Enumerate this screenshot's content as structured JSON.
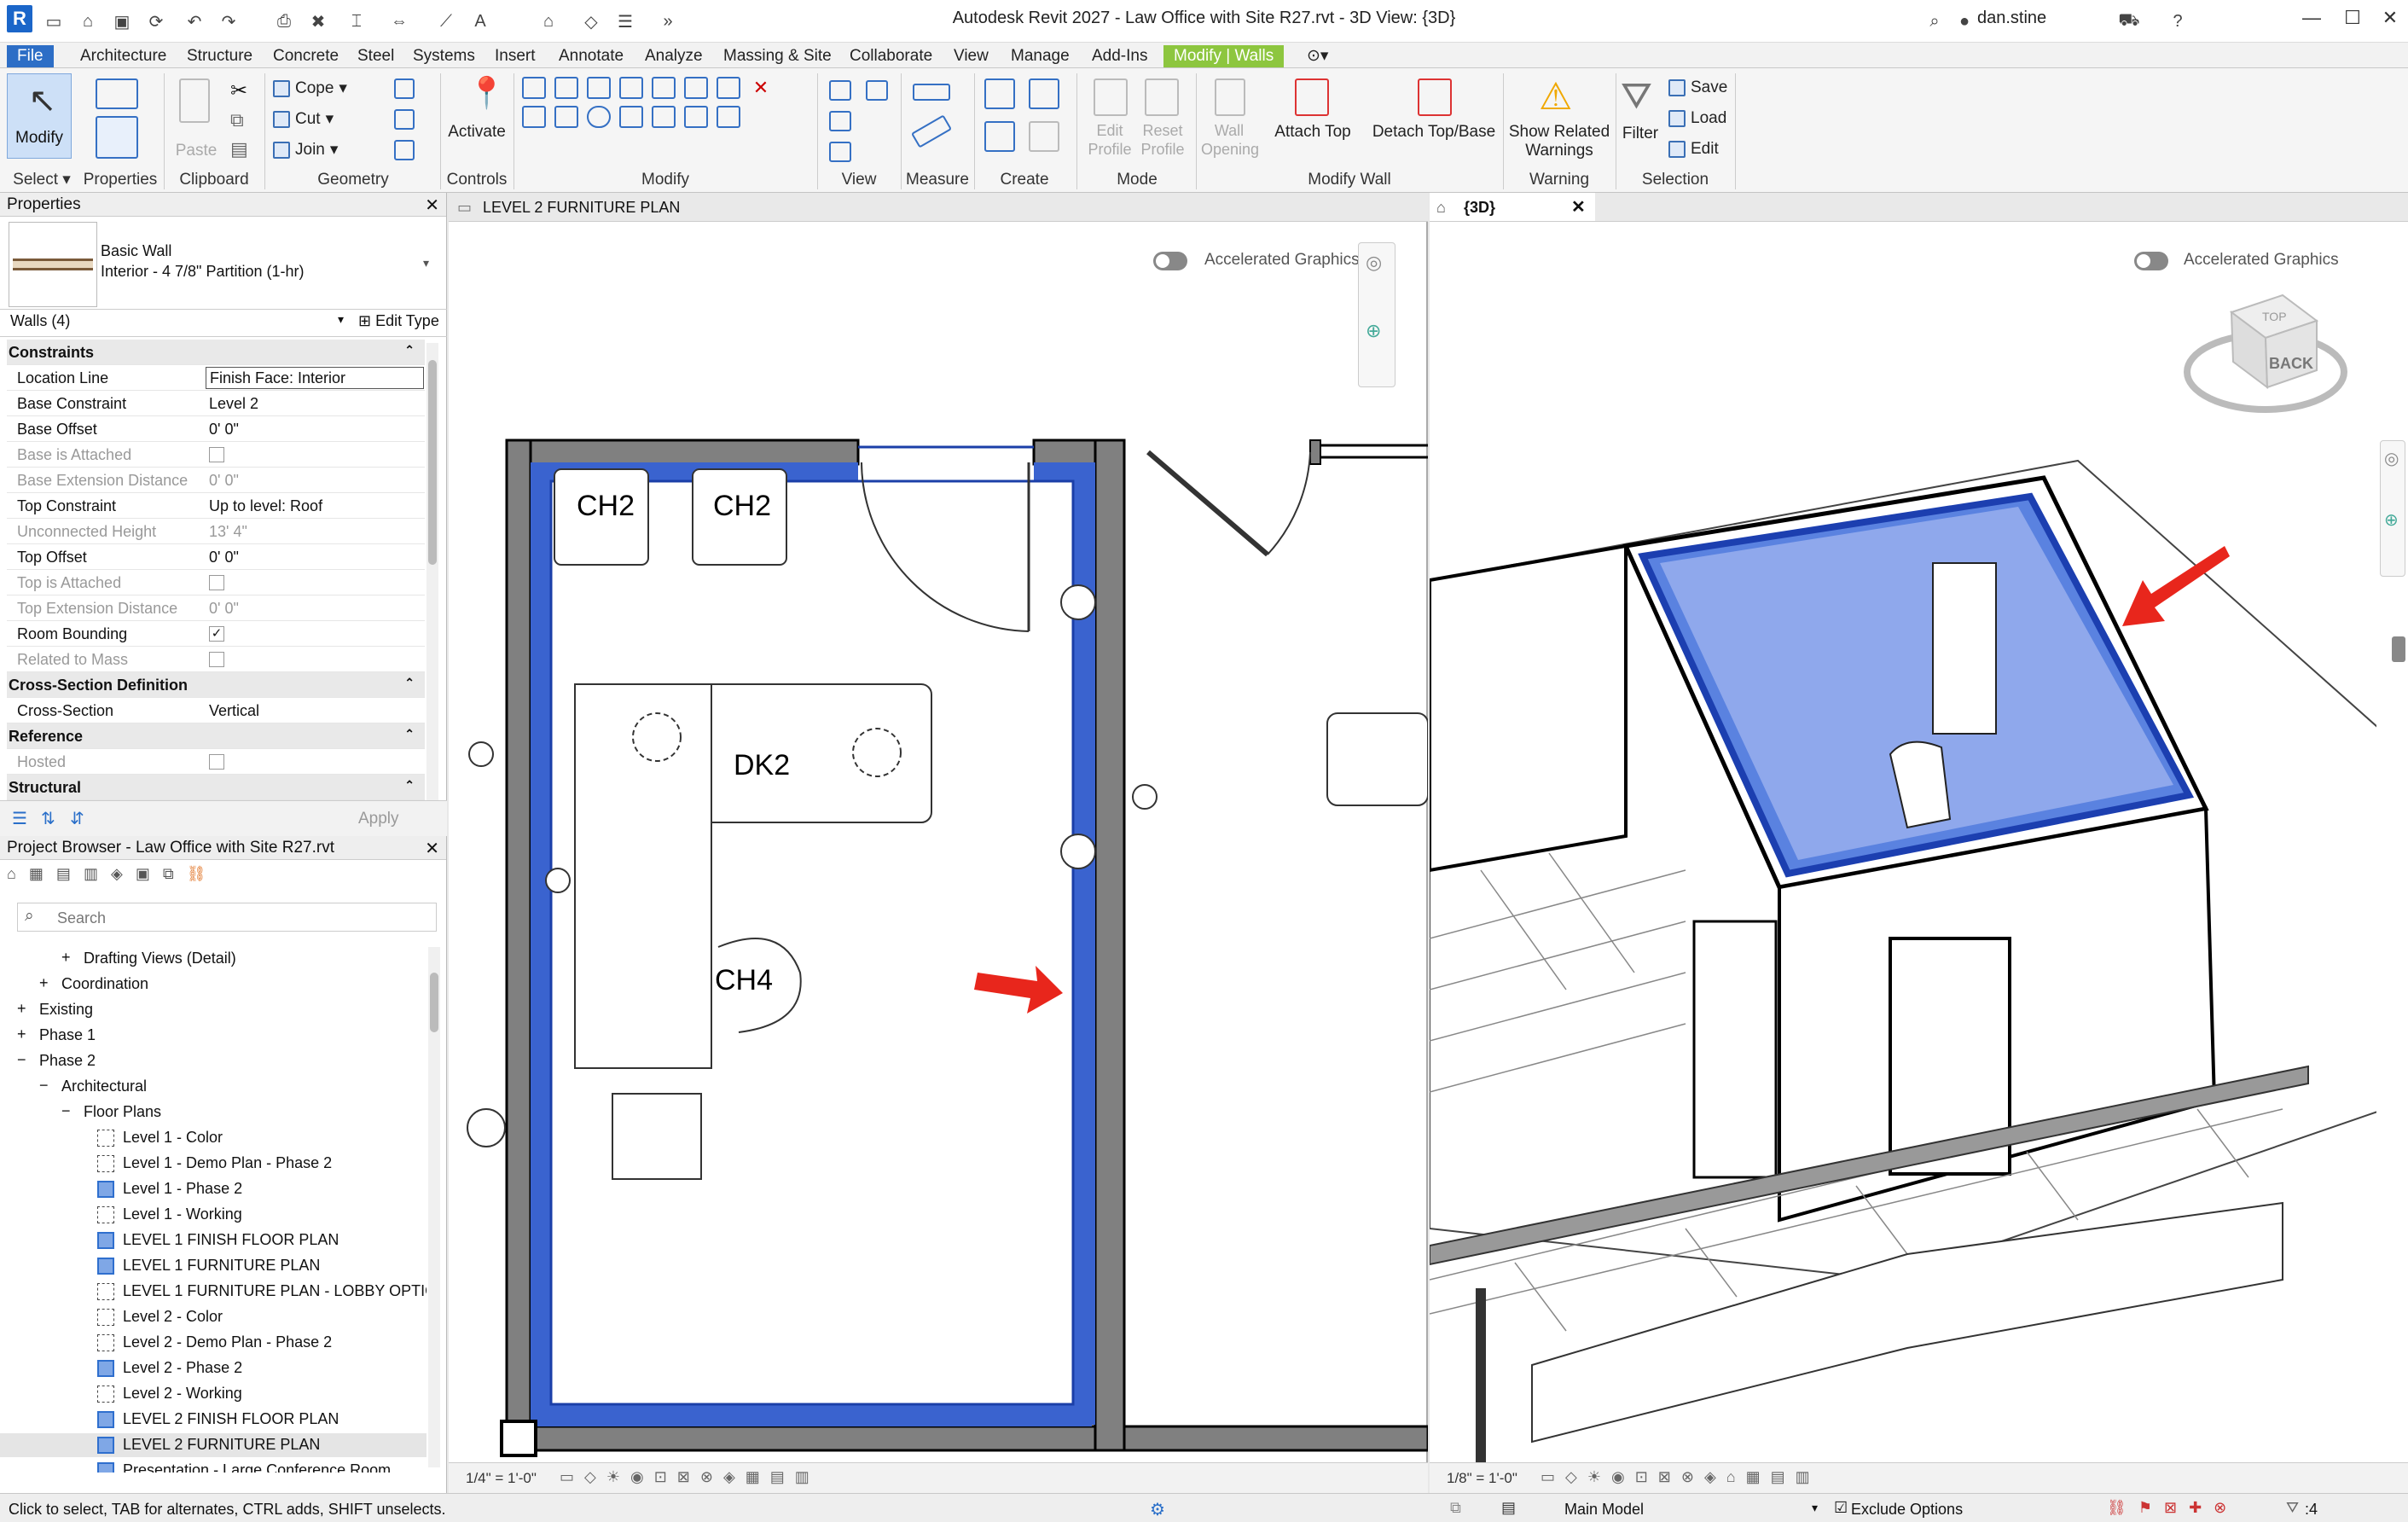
{
  "window": {
    "title": "Autodesk Revit 2027 - Law Office with Site R27.rvt - 3D View: {3D}",
    "user": "dan.stine",
    "logo": "R"
  },
  "tabs": [
    "File",
    "Architecture",
    "Structure",
    "Concrete",
    "Steel",
    "Systems",
    "Insert",
    "Annotate",
    "Analyze",
    "Massing & Site",
    "Collaborate",
    "View",
    "Manage",
    "Add-Ins",
    "Modify | Walls"
  ],
  "ribbon": {
    "modify": "Modify",
    "select": "Select",
    "properties": "Properties",
    "paste": "Paste",
    "clipboard": "Clipboard",
    "cope": "Cope",
    "cut": "Cut",
    "join": "Join",
    "geometry": "Geometry",
    "activate": "Activate",
    "controls": "Controls",
    "modify_panel": "Modify",
    "view_panel": "View",
    "measure": "Measure",
    "create": "Create",
    "edit_profile": "Edit Profile",
    "reset_profile": "Reset Profile",
    "mode": "Mode",
    "wall_opening": "Wall Opening",
    "attach_top": "Attach Top",
    "detach_top_base": "Detach Top/Base",
    "modify_wall": "Modify Wall",
    "show_related_warnings": "Show Related Warnings",
    "warning": "Warning",
    "filter": "Filter",
    "save": "Save",
    "load": "Load",
    "edit": "Edit",
    "selection": "Selection"
  },
  "properties": {
    "title": "Properties",
    "type_family": "Basic Wall",
    "type_name": "Interior - 4 7/8\" Partition (1-hr)",
    "selection": "Walls (4)",
    "edit_type": "Edit Type",
    "apply": "Apply",
    "rows": [
      {
        "k": "Constraints",
        "section": true
      },
      {
        "k": "Location Line",
        "v": "Finish Face: Interior",
        "input": true
      },
      {
        "k": "Base Constraint",
        "v": "Level 2"
      },
      {
        "k": "Base Offset",
        "v": "0'  0\""
      },
      {
        "k": "Base is Attached",
        "chk": "",
        "dis": true
      },
      {
        "k": "Base Extension Distance",
        "v": "0'  0\"",
        "dis": true
      },
      {
        "k": "Top Constraint",
        "v": "Up to level: Roof"
      },
      {
        "k": "Unconnected Height",
        "v": "13'  4\"",
        "dis": true
      },
      {
        "k": "Top Offset",
        "v": "0'  0\""
      },
      {
        "k": "Top is Attached",
        "chk": "",
        "dis": true
      },
      {
        "k": "Top Extension Distance",
        "v": "0'  0\"",
        "dis": true
      },
      {
        "k": "Room Bounding",
        "chk": "✓"
      },
      {
        "k": "Related to Mass",
        "chk": "",
        "dis": true
      },
      {
        "k": "Cross-Section Definition",
        "section": true
      },
      {
        "k": "Cross-Section",
        "v": "Vertical"
      },
      {
        "k": "Reference",
        "section": true
      },
      {
        "k": "Hosted",
        "chk": "",
        "dis": true
      },
      {
        "k": "Structural",
        "section": true
      }
    ]
  },
  "project_browser": {
    "title": "Project Browser - Law Office with Site R27.rvt",
    "search_placeholder": "Search",
    "items": [
      {
        "t": "Drafting Views (Detail)",
        "lvl": 2,
        "exp": "+"
      },
      {
        "t": "Coordination",
        "lvl": 1,
        "exp": "+"
      },
      {
        "t": "Existing",
        "lvl": 0,
        "exp": "+"
      },
      {
        "t": "Phase 1",
        "lvl": 0,
        "exp": "+"
      },
      {
        "t": "Phase 2",
        "lvl": 0,
        "exp": "−"
      },
      {
        "t": "Architectural",
        "lvl": 1,
        "exp": "−"
      },
      {
        "t": "Floor Plans",
        "lvl": 2,
        "exp": "−"
      },
      {
        "t": "Level 1 - Color",
        "lvl": 3,
        "icon": "plain"
      },
      {
        "t": "Level 1 - Demo Plan - Phase 2",
        "lvl": 3,
        "icon": "plain"
      },
      {
        "t": "Level 1 - Phase 2",
        "lvl": 3,
        "icon": "blue"
      },
      {
        "t": "Level 1 - Working",
        "lvl": 3,
        "icon": "plain"
      },
      {
        "t": "LEVEL 1 FINISH FLOOR PLAN",
        "lvl": 3,
        "icon": "blue"
      },
      {
        "t": "LEVEL 1 FURNITURE PLAN",
        "lvl": 3,
        "icon": "blue"
      },
      {
        "t": "LEVEL 1 FURNITURE PLAN - LOBBY OPTIO",
        "lvl": 3,
        "icon": "plain"
      },
      {
        "t": "Level 2 - Color",
        "lvl": 3,
        "icon": "plain"
      },
      {
        "t": "Level 2 - Demo Plan - Phase 2",
        "lvl": 3,
        "icon": "plain"
      },
      {
        "t": "Level 2 - Phase 2",
        "lvl": 3,
        "icon": "blue"
      },
      {
        "t": "Level 2 - Working",
        "lvl": 3,
        "icon": "plain"
      },
      {
        "t": "LEVEL 2 FINISH FLOOR PLAN",
        "lvl": 3,
        "icon": "blue"
      },
      {
        "t": "LEVEL 2 FURNITURE PLAN",
        "lvl": 3,
        "icon": "blue"
      },
      {
        "t": "Presentation - Large Conference Room",
        "lvl": 3,
        "icon": "blue"
      }
    ]
  },
  "view_plan": {
    "tab": "LEVEL 2 FURNITURE PLAN",
    "accel": "Accelerated Graphics",
    "scale": "1/4\" = 1'-0\"",
    "labels": {
      "ch2a": "CH2",
      "ch2b": "CH2",
      "dk2": "DK2",
      "ch4": "CH4"
    }
  },
  "view_3d": {
    "tab": "{3D}",
    "accel": "Accelerated Graphics",
    "scale": "1/8\" = 1'-0\"",
    "cube_face": "BACK",
    "cube_top": "TOP"
  },
  "status": {
    "hint": "Click to select, TAB for alternates, CTRL adds, SHIFT unselects.",
    "model": "Main Model",
    "exclude": "Exclude Options",
    "filter_count": ":4"
  },
  "colors": {
    "accent": "#2d6ec6",
    "selection": "#3a63cf",
    "context_tab": "#8dc63f",
    "arrow": "#e8261c"
  }
}
